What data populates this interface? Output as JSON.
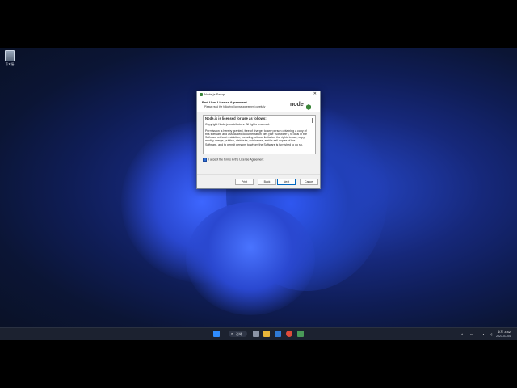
{
  "desktop": {
    "recycle_bin_label": "휴지통"
  },
  "dialog": {
    "title": "Node.js Setup",
    "header_title": "End-User License Agreement",
    "header_subtitle": "Please read the following license agreement carefully",
    "logo_text": "node",
    "license_paragraphs": [
      "Node.js is licensed for use as follows:",
      "Copyright Node.js contributors. All rights reserved.",
      "Permission is hereby granted, free of charge, to any person obtaining a copy of this software and associated documentation files (the \"Software\"), to deal in the Software without restriction, including without limitation the rights to use, copy, modify, merge, publish, distribute, sublicense, and/or sell copies of the Software, and to permit persons to whom the Software is furnished to do so,"
    ],
    "accept_label": "I accept the terms in the License Agreement",
    "accept_checked": true,
    "buttons": {
      "print": "Print",
      "back": "Back",
      "next": "Next",
      "cancel": "Cancel"
    }
  },
  "taskbar": {
    "search_label": "검색",
    "clock_time": "오후 3:42",
    "clock_date": "2023-03-04"
  },
  "colors": {
    "node_green": "#3c873a",
    "accent": "#0067c0"
  }
}
